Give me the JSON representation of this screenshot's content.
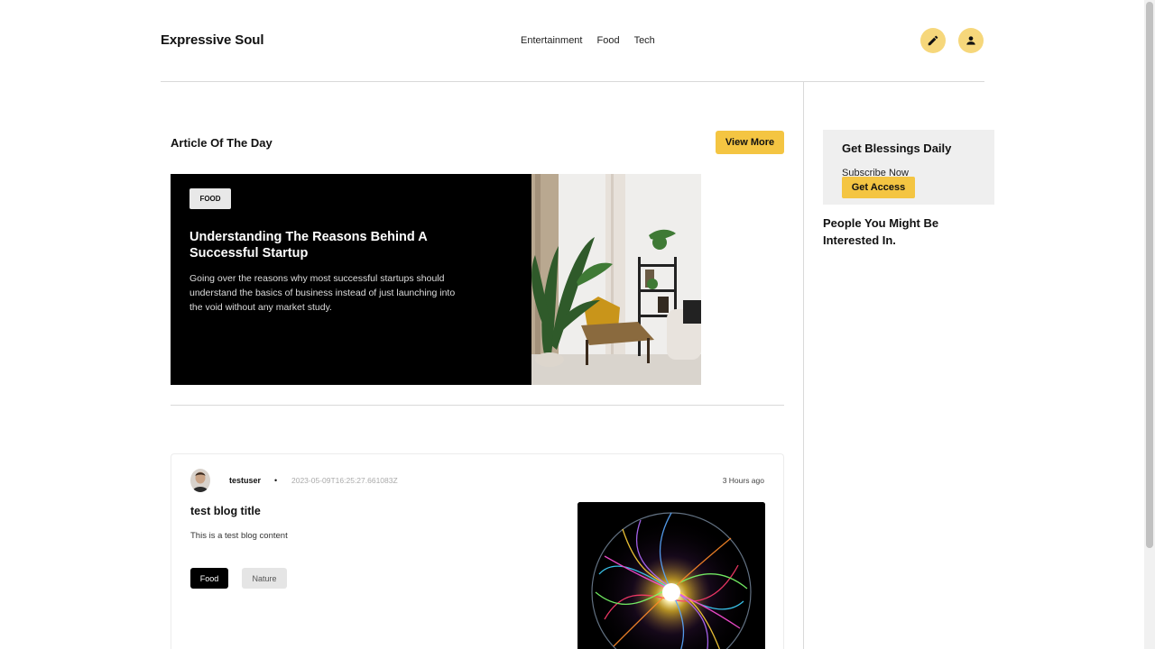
{
  "header": {
    "brand": "Expressive Soul",
    "nav": [
      "Entertainment",
      "Food",
      "Tech"
    ],
    "icons": [
      "pencil-icon",
      "user-icon"
    ],
    "accent_color": "#f6d77b"
  },
  "article_of_day": {
    "heading": "Article Of The Day",
    "view_more_label": "View More",
    "tag": "FOOD",
    "title": "Understanding The Reasons Behind A Successful Startup",
    "excerpt": "Going over the reasons why most successful startups should understand the basics of business instead of just launching into the void without any market study."
  },
  "post": {
    "username": "testuser",
    "separator": "•",
    "timestamp": "2023-05-09T16:25:27.661083Z",
    "relative_time": "3 Hours ago",
    "title": "test blog title",
    "content": "This is a test blog content",
    "tags": [
      "Food",
      "Nature"
    ]
  },
  "sidebar": {
    "subscribe_title": "Get Blessings Daily",
    "subscribe_text": "Subscribe Now",
    "access_label": "Get Access",
    "people_heading": "People You Might Be Interested In."
  },
  "colors": {
    "button_yellow": "#f4c542",
    "feature_bg": "#000000",
    "panel_bg": "#efefef"
  }
}
